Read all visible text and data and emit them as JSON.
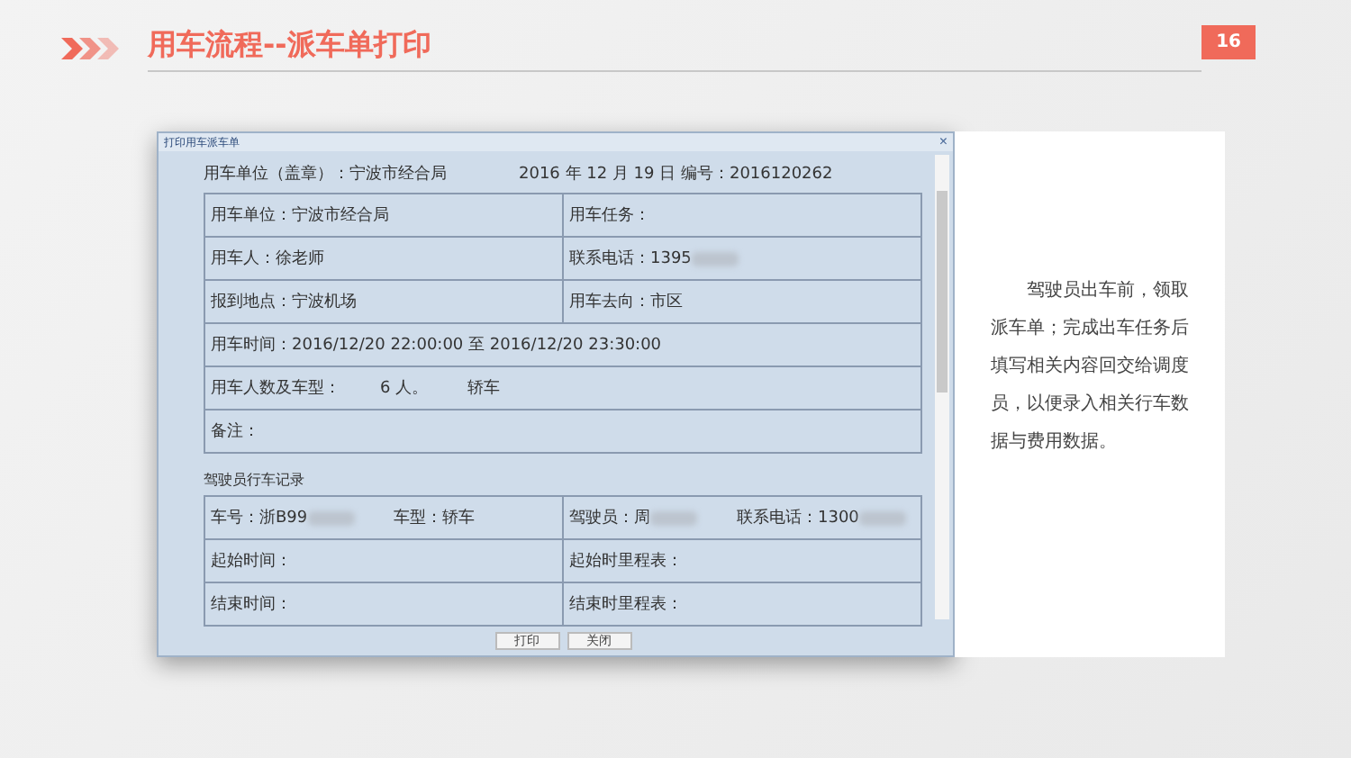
{
  "header": {
    "title": "用车流程--派车单打印",
    "page": "16"
  },
  "dialog": {
    "title": "打印用车派车单",
    "close": "×",
    "unit_line": "用车单位（盖章）：宁波市经合局",
    "date_line": "2016 年 12 月 19 日 编号：2016120262",
    "order_rows": [
      {
        "cells": [
          [
            {
              "text": "用车单位：宁波市经合局"
            }
          ],
          [
            {
              "text": "用车任务："
            }
          ]
        ]
      },
      {
        "cells": [
          [
            {
              "text": "用车人：徐老师"
            }
          ],
          [
            {
              "text": "联系电话：1395",
              "redacted": true
            }
          ]
        ]
      },
      {
        "cells": [
          [
            {
              "text": "报到地点：宁波机场"
            }
          ],
          [
            {
              "text": "用车去向：市区"
            }
          ]
        ]
      },
      {
        "cells": [
          [
            {
              "text": "用车时间：2016/12/20 22:00:00 至 2016/12/20 23:30:00"
            }
          ]
        ]
      },
      {
        "cells": [
          [
            {
              "text": "用车人数及车型："
            },
            {
              "text": "6 人。"
            },
            {
              "text": "轿车"
            }
          ]
        ]
      },
      {
        "cells": [
          [
            {
              "text": "备注："
            }
          ]
        ]
      }
    ],
    "section_title": "驾驶员行车记录",
    "record_rows": [
      {
        "cells": [
          [
            {
              "text": "车号：浙B99",
              "redacted": true
            },
            {
              "text": "车型：轿车"
            }
          ],
          [
            {
              "text": "驾驶员：周",
              "redacted": true
            },
            {
              "text": "联系电话：1300",
              "redacted": true
            }
          ]
        ]
      },
      {
        "cells": [
          [
            {
              "text": "起始时间："
            }
          ],
          [
            {
              "text": "起始时里程表："
            }
          ]
        ]
      },
      {
        "cells": [
          [
            {
              "text": "结束时间："
            }
          ],
          [
            {
              "text": "结束时里程表："
            }
          ]
        ]
      }
    ],
    "buttons": [
      "打印",
      "关闭"
    ]
  },
  "note": "驾驶员出车前，领取派车单；完成出车任务后填写相关内容回交给调度员，以便录入相关行车数据与费用数据。"
}
